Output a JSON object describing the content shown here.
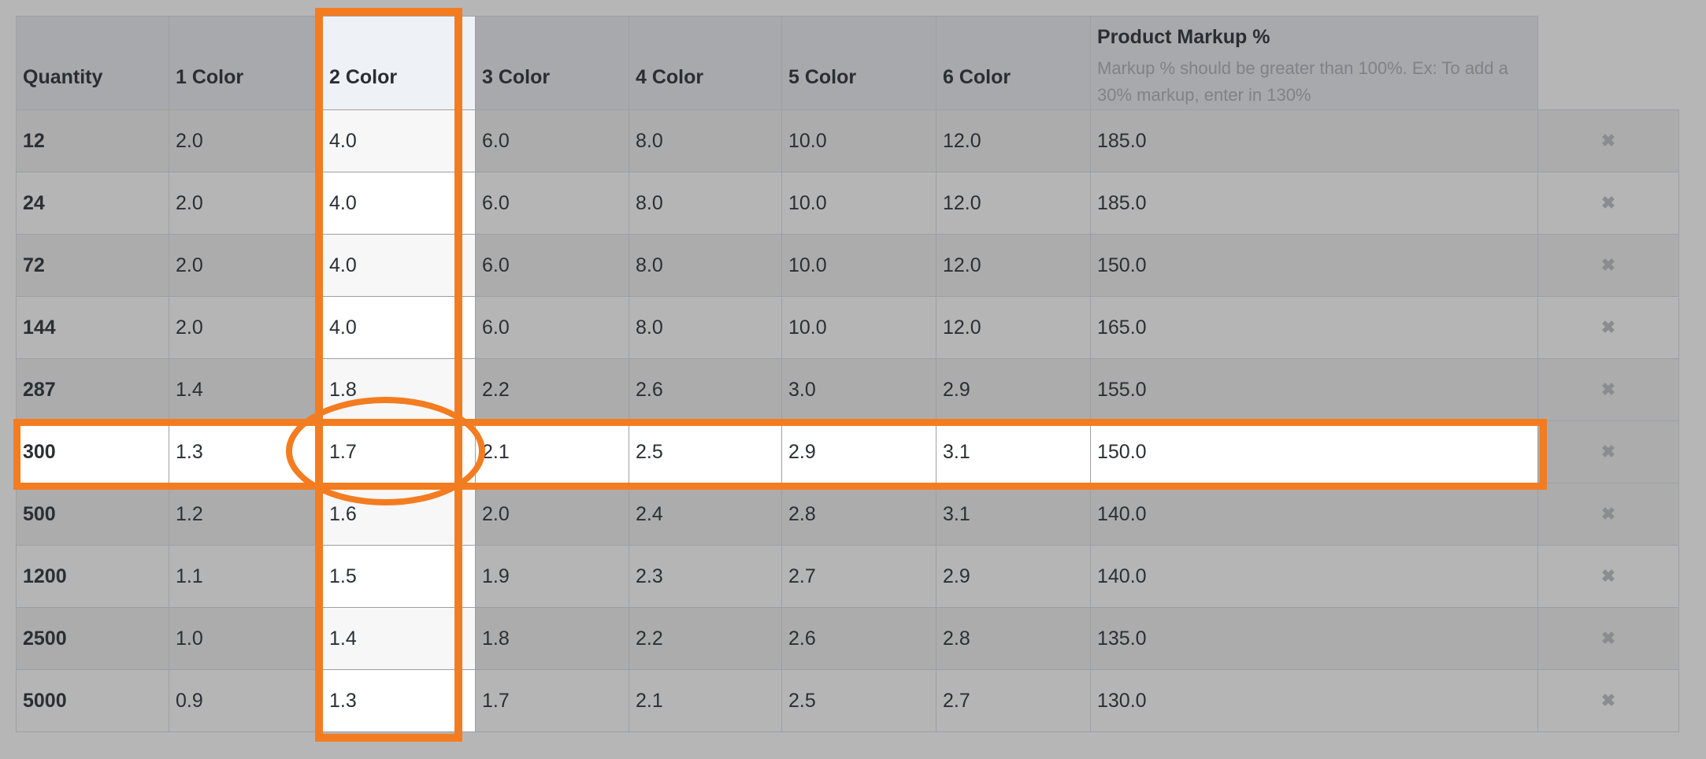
{
  "table": {
    "headers": [
      "Quantity",
      "1 Color",
      "2 Color",
      "3 Color",
      "4 Color",
      "5 Color",
      "6 Color"
    ],
    "markup_header": {
      "title": "Product Markup %",
      "note": "Markup % should be greater than 100%. Ex: To add a 30% markup, enter in 130%"
    },
    "delete_icon": "close-icon",
    "rows": [
      [
        "12",
        "2.0",
        "4.0",
        "6.0",
        "8.0",
        "10.0",
        "12.0",
        "185.0"
      ],
      [
        "24",
        "2.0",
        "4.0",
        "6.0",
        "8.0",
        "10.0",
        "12.0",
        "185.0"
      ],
      [
        "72",
        "2.0",
        "4.0",
        "6.0",
        "8.0",
        "10.0",
        "12.0",
        "150.0"
      ],
      [
        "144",
        "2.0",
        "4.0",
        "6.0",
        "8.0",
        "10.0",
        "12.0",
        "165.0"
      ],
      [
        "287",
        "1.4",
        "1.8",
        "2.2",
        "2.6",
        "3.0",
        "2.9",
        "155.0"
      ],
      [
        "300",
        "1.3",
        "1.7",
        "2.1",
        "2.5",
        "2.9",
        "3.1",
        "150.0"
      ],
      [
        "500",
        "1.2",
        "1.6",
        "2.0",
        "2.4",
        "2.8",
        "3.1",
        "140.0"
      ],
      [
        "1200",
        "1.1",
        "1.5",
        "1.9",
        "2.3",
        "2.7",
        "2.9",
        "140.0"
      ],
      [
        "2500",
        "1.0",
        "1.4",
        "1.8",
        "2.2",
        "2.6",
        "2.8",
        "135.0"
      ],
      [
        "5000",
        "0.9",
        "1.3",
        "1.7",
        "2.1",
        "2.5",
        "2.7",
        "130.0"
      ]
    ]
  },
  "annotations": {
    "highlight_color": "#f47c20",
    "highlighted_column": "2 Color",
    "highlighted_row": "300"
  }
}
